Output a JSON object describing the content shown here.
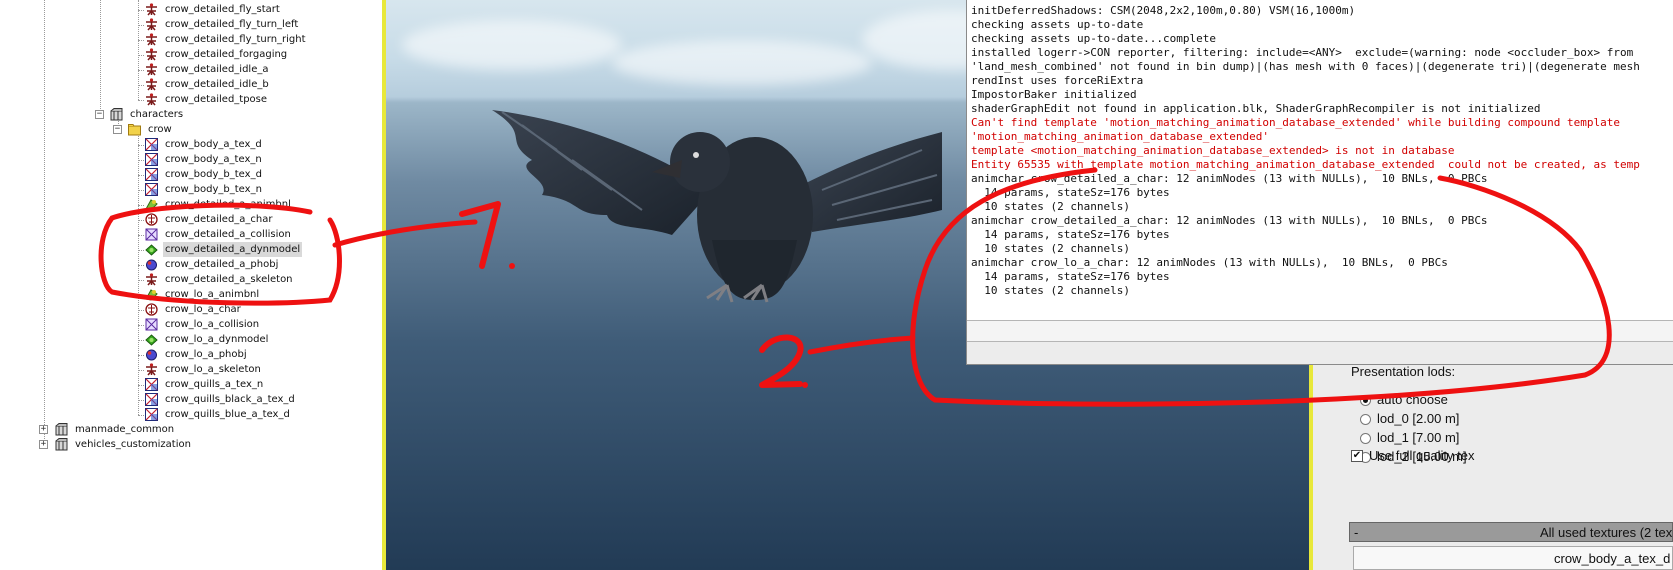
{
  "tree": {
    "items": [
      {
        "label": "crow_detailed_fly_start",
        "icon": "skeleton-icon"
      },
      {
        "label": "crow_detailed_fly_turn_left",
        "icon": "skeleton-icon"
      },
      {
        "label": "crow_detailed_fly_turn_right",
        "icon": "skeleton-icon"
      },
      {
        "label": "crow_detailed_forgaging",
        "icon": "skeleton-icon"
      },
      {
        "label": "crow_detailed_idle_a",
        "icon": "skeleton-icon"
      },
      {
        "label": "crow_detailed_idle_b",
        "icon": "skeleton-icon"
      },
      {
        "label": "crow_detailed_tpose",
        "icon": "skeleton-icon"
      },
      {
        "label": "characters",
        "icon": "package-icon"
      },
      {
        "label": "crow",
        "icon": "folder-icon"
      },
      {
        "label": "crow_body_a_tex_d",
        "icon": "texture-icon"
      },
      {
        "label": "crow_body_a_tex_n",
        "icon": "texture-icon"
      },
      {
        "label": "crow_body_b_tex_d",
        "icon": "texture-icon"
      },
      {
        "label": "crow_body_b_tex_n",
        "icon": "texture-icon"
      },
      {
        "label": "crow_detailed_a_animbnl",
        "icon": "animbnl-icon"
      },
      {
        "label": "crow_detailed_a_char",
        "icon": "char-icon"
      },
      {
        "label": "crow_detailed_a_collision",
        "icon": "collision-icon"
      },
      {
        "label": "crow_detailed_a_dynmodel",
        "icon": "dynmodel-icon"
      },
      {
        "label": "crow_detailed_a_phobj",
        "icon": "phobj-icon"
      },
      {
        "label": "crow_detailed_a_skeleton",
        "icon": "skeleton-icon"
      },
      {
        "label": "crow_lo_a_animbnl",
        "icon": "animbnl-icon"
      },
      {
        "label": "crow_lo_a_char",
        "icon": "char-icon"
      },
      {
        "label": "crow_lo_a_collision",
        "icon": "collision-icon"
      },
      {
        "label": "crow_lo_a_dynmodel",
        "icon": "dynmodel-icon"
      },
      {
        "label": "crow_lo_a_phobj",
        "icon": "phobj-icon"
      },
      {
        "label": "crow_lo_a_skeleton",
        "icon": "skeleton-icon"
      },
      {
        "label": "crow_quills_a_tex_n",
        "icon": "texture-icon"
      },
      {
        "label": "crow_quills_black_a_tex_d",
        "icon": "texture-icon"
      },
      {
        "label": "crow_quills_blue_a_tex_d",
        "icon": "texture-icon"
      },
      {
        "label": "manmade_common",
        "icon": "package-icon"
      },
      {
        "label": "vehicles_customization",
        "icon": "package-icon"
      }
    ],
    "selected": "crow_detailed_a_dynmodel"
  },
  "annotations": {
    "marker_1": "1.",
    "marker_2": "2.",
    "color": "#ee1111"
  },
  "console": {
    "lines": [
      {
        "text": "initDeferredShadows: CSM(2048,2x2,100m,0.80) VSM(16,1000m)",
        "error": false
      },
      {
        "text": "checking assets up-to-date",
        "error": false
      },
      {
        "text": "checking assets up-to-date...complete",
        "error": false
      },
      {
        "text": "installed logerr->CON reporter, filtering: include=<ANY>  exclude=(warning: node <occluder_box> from",
        "error": false
      },
      {
        "text": "'land_mesh_combined' not found in bin dump)|(has mesh with 0 faces)|(degenerate tri)|(degenerate mesh",
        "error": false
      },
      {
        "text": "rendInst uses forceRiExtra",
        "error": false
      },
      {
        "text": "ImpostorBaker initialized",
        "error": false
      },
      {
        "text": "shaderGraphEdit not found in application.blk, ShaderGraphRecompiler is not initialized",
        "error": false
      },
      {
        "text": "Can't find template 'motion_matching_animation_database_extended' while building compound template",
        "error": true
      },
      {
        "text": "'motion_matching_animation_database_extended'",
        "error": true
      },
      {
        "text": "template <motion_matching_animation_database_extended> is not in database",
        "error": true
      },
      {
        "text": "Entity 65535 with template motion_matching_animation_database_extended  could not be created, as temp",
        "error": true
      },
      {
        "text": "animchar crow_detailed_a_char: 12 animNodes (13 with NULLs),  10 BNLs,  0 PBCs",
        "error": false
      },
      {
        "text": "  14 params, stateSz=176 bytes",
        "error": false
      },
      {
        "text": "  10 states (2 channels)",
        "error": false
      },
      {
        "text": "animchar crow_detailed_a_char: 12 animNodes (13 with NULLs),  10 BNLs,  0 PBCs",
        "error": false
      },
      {
        "text": "  14 params, stateSz=176 bytes",
        "error": false
      },
      {
        "text": "  10 states (2 channels)",
        "error": false
      },
      {
        "text": "animchar crow_lo_a_char: 12 animNodes (13 with NULLs),  10 BNLs,  0 PBCs",
        "error": false
      },
      {
        "text": "  14 params, stateSz=176 bytes",
        "error": false
      },
      {
        "text": "  10 states (2 channels)",
        "error": false
      }
    ]
  },
  "props": {
    "lods_title": "Presentation lods:",
    "lod_options": [
      {
        "label": "auto choose",
        "checked": true
      },
      {
        "label": "lod_0 [2.00 m]",
        "checked": false
      },
      {
        "label": "lod_1 [7.00 m]",
        "checked": false
      },
      {
        "label": "lod_2 [15.00 m]",
        "checked": false
      }
    ],
    "full_quality_label": "Use full quality tex",
    "full_quality_checked": true,
    "textures_collapse": "-",
    "textures_header": "All used textures (2 tex",
    "texture_row": "crow_body_a_tex_d"
  }
}
